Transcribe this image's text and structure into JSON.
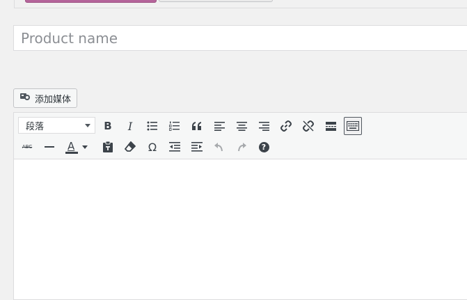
{
  "title_field": {
    "placeholder": "Product name",
    "value": ""
  },
  "add_media_label": "添加媒体",
  "format_select": {
    "selected": "段落"
  },
  "colors": {
    "accent_tab": "#b5659b",
    "icon": "#3c434a",
    "disabled_icon": "#a7aaad"
  },
  "toolbar_row1": [
    "bold",
    "italic",
    "bulleted-list",
    "numbered-list",
    "blockquote",
    "align-left",
    "align-center",
    "align-right",
    "insert-link",
    "remove-link",
    "read-more",
    "toolbar-toggle"
  ],
  "toolbar_row2": [
    "strikethrough",
    "horizontal-line",
    "text-color",
    "paste-as-text",
    "clear-formatting",
    "special-character",
    "decrease-indent",
    "increase-indent",
    "undo",
    "redo",
    "help"
  ],
  "labels": {
    "bold": "B",
    "italic": "I",
    "strikethrough": "ABC",
    "text_color": "A",
    "special_character": "Ω",
    "help": "?"
  }
}
